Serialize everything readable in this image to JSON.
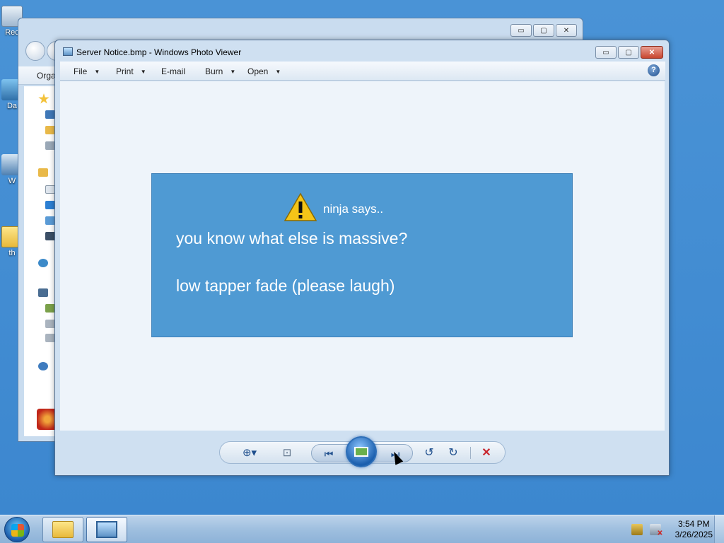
{
  "desktop": {
    "icons": [
      {
        "label": "Rec"
      },
      {
        "label": "Da"
      },
      {
        "label": "W"
      },
      {
        "label": "th"
      }
    ]
  },
  "explorer": {
    "toolbar_label": "Orga",
    "window_buttons": {
      "minimize": "▭",
      "maximize": "▢",
      "close": "✕"
    }
  },
  "viewer": {
    "title": "Server Notice.bmp - Windows Photo Viewer",
    "window_buttons": {
      "minimize": "▭",
      "maximize": "▢",
      "close": "✕"
    },
    "menu": {
      "file": "File",
      "print": "Print",
      "email": "E-mail",
      "burn": "Burn",
      "open": "Open",
      "help": "?"
    },
    "image": {
      "header": "ninja says..",
      "line1": "you know what else is massive?",
      "line2": "low tapper fade (please laugh)"
    },
    "controls": {
      "zoom": "⊕▾",
      "fit": "⊡",
      "previous": "⏮",
      "next": "⏭",
      "rotate_left": "↺",
      "rotate_right": "↻",
      "delete": "✕"
    }
  },
  "taskbar": {
    "clock_time": "3:54 PM",
    "clock_date": "3/26/2025"
  },
  "colors": {
    "desktop": "#3e8ad1",
    "notice_bg": "#4f9ad3",
    "delete": "#c8262e"
  }
}
